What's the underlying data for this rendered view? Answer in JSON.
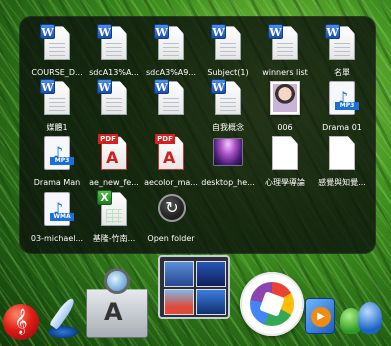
{
  "stack": {
    "items": [
      {
        "label": "COURSE_D...",
        "type": "word"
      },
      {
        "label": "sdcA13%A...",
        "type": "word"
      },
      {
        "label": "sdcA3%A9...",
        "type": "word"
      },
      {
        "label": "Subject(1)",
        "type": "word"
      },
      {
        "label": "winners list",
        "type": "word"
      },
      {
        "label": "名單",
        "type": "word"
      },
      {
        "label": "媒體1",
        "type": "word"
      },
      {
        "label": "",
        "type": "word"
      },
      {
        "label": "",
        "type": "word"
      },
      {
        "label": "自我概念",
        "type": "word"
      },
      {
        "label": "006",
        "type": "photo"
      },
      {
        "label": "Drama 01",
        "type": "mp3"
      },
      {
        "label": "Drama Man",
        "type": "mp3"
      },
      {
        "label": "ae_new_fe...",
        "type": "pdf"
      },
      {
        "label": "aecolor_ma...",
        "type": "pdf"
      },
      {
        "label": "desktop_he...",
        "type": "image"
      },
      {
        "label": "心理學導論",
        "type": "blank"
      },
      {
        "label": "感覺與知覺...",
        "type": "blank"
      },
      {
        "label": "03-michael...",
        "type": "wma"
      },
      {
        "label": "基隆-竹南...",
        "type": "excel"
      },
      {
        "label": "Open folder",
        "type": "open-folder"
      }
    ],
    "badges": {
      "word": "W",
      "pdf": "PDF",
      "mp3": "MP3",
      "wma": "WMA",
      "excel": "X",
      "acrobat": "A",
      "note": "♪",
      "open": "↻"
    }
  },
  "dock": {
    "items": [
      {
        "name": "music-player",
        "glyph": "𝄞"
      },
      {
        "name": "writer"
      },
      {
        "name": "applications",
        "glyph": "A"
      },
      {
        "name": "windows-explorer"
      },
      {
        "name": "picasa"
      },
      {
        "name": "media-player",
        "glyph": "▶"
      },
      {
        "name": "messenger"
      }
    ]
  }
}
